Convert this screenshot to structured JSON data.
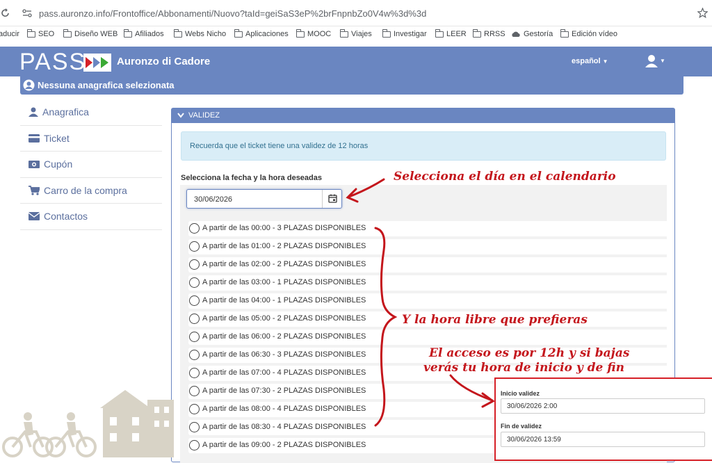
{
  "browser": {
    "url": "pass.auronzo.info/Frontoffice/Abbonamenti/Nuovo?taId=geiSaS3eP%2brFnpnbZo0V4w%3d%3d",
    "bookmarks": [
      {
        "label": "aducir"
      },
      {
        "label": "SEO"
      },
      {
        "label": "Diseño WEB"
      },
      {
        "label": "Afiliados"
      },
      {
        "label": "Webs Nicho"
      },
      {
        "label": "Aplicaciones"
      },
      {
        "label": "MOOC"
      },
      {
        "label": "Viajes"
      },
      {
        "label": "Investigar"
      },
      {
        "label": "LEER"
      },
      {
        "label": "RRSS"
      },
      {
        "label": "Gestoría"
      },
      {
        "label": "Edición vídeo"
      }
    ]
  },
  "header": {
    "logo": "PASS",
    "site_name": "Auronzo di Cadore",
    "language": "español",
    "subheader": "Nessuna anagrafica selezionata",
    "brand_color": "#6a86c1"
  },
  "sidebar": {
    "items": [
      {
        "label": "Anagrafica",
        "icon": "user-icon"
      },
      {
        "label": "Ticket",
        "icon": "ticket-icon"
      },
      {
        "label": "Cupón",
        "icon": "coupon-icon"
      },
      {
        "label": "Carro de la compra",
        "icon": "cart-icon"
      },
      {
        "label": "Contactos",
        "icon": "envelope-icon"
      }
    ]
  },
  "panel": {
    "title": "VALIDEZ",
    "notice": "Recuerda que el ticket tiene una validez de 12 horas",
    "select_label": "Selecciona la fecha y la hora deseadas",
    "date_value": "30/06/2026",
    "slots": [
      {
        "label": "A partir de las 00:00 - 3 PLAZAS DISPONIBLES"
      },
      {
        "label": "A partir de las 01:00 - 2 PLAZAS DISPONIBLES"
      },
      {
        "label": "A partir de las 02:00 - 2 PLAZAS DISPONIBLES"
      },
      {
        "label": "A partir de las 03:00 - 1 PLAZAS DISPONIBLES"
      },
      {
        "label": "A partir de las 04:00 - 1 PLAZAS DISPONIBLES"
      },
      {
        "label": "A partir de las 05:00 - 2 PLAZAS DISPONIBLES"
      },
      {
        "label": "A partir de las 06:00 - 2 PLAZAS DISPONIBLES"
      },
      {
        "label": "A partir de las 06:30 - 3 PLAZAS DISPONIBLES"
      },
      {
        "label": "A partir de las 07:00 - 4 PLAZAS DISPONIBLES"
      },
      {
        "label": "A partir de las 07:30 - 2 PLAZAS DISPONIBLES"
      },
      {
        "label": "A partir de las 08:00 - 4 PLAZAS DISPONIBLES"
      },
      {
        "label": "A partir de las 08:30 - 4 PLAZAS DISPONIBLES"
      },
      {
        "label": "A partir de las 09:00 - 2 PLAZAS DISPONIBLES"
      }
    ]
  },
  "validity": {
    "start_label": "Inicio validez",
    "start_value": "30/06/2026 2:00",
    "end_label": "Fin de validez",
    "end_value": "30/06/2026 13:59"
  },
  "annotations": {
    "calendar": "Selecciona el día en el calendario",
    "hour": "Y la hora libre que prefieras",
    "access_line1": "El acceso es por 12h y si bajas",
    "access_line2": "verás tu hora de inicio y de fin",
    "color": "#c4161c"
  }
}
